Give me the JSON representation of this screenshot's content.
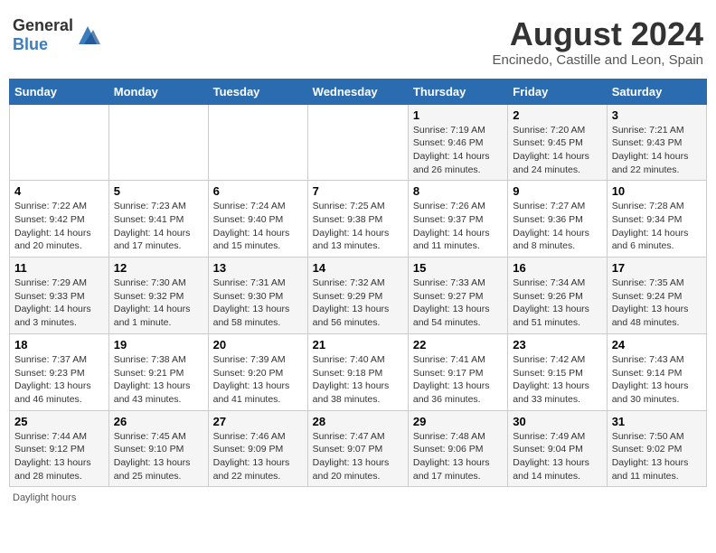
{
  "header": {
    "logo_general": "General",
    "logo_blue": "Blue",
    "month_year": "August 2024",
    "location": "Encinedo, Castille and Leon, Spain"
  },
  "days_of_week": [
    "Sunday",
    "Monday",
    "Tuesday",
    "Wednesday",
    "Thursday",
    "Friday",
    "Saturday"
  ],
  "weeks": [
    [
      {
        "day": "",
        "info": ""
      },
      {
        "day": "",
        "info": ""
      },
      {
        "day": "",
        "info": ""
      },
      {
        "day": "",
        "info": ""
      },
      {
        "day": "1",
        "info": "Sunrise: 7:19 AM\nSunset: 9:46 PM\nDaylight: 14 hours and 26 minutes."
      },
      {
        "day": "2",
        "info": "Sunrise: 7:20 AM\nSunset: 9:45 PM\nDaylight: 14 hours and 24 minutes."
      },
      {
        "day": "3",
        "info": "Sunrise: 7:21 AM\nSunset: 9:43 PM\nDaylight: 14 hours and 22 minutes."
      }
    ],
    [
      {
        "day": "4",
        "info": "Sunrise: 7:22 AM\nSunset: 9:42 PM\nDaylight: 14 hours and 20 minutes."
      },
      {
        "day": "5",
        "info": "Sunrise: 7:23 AM\nSunset: 9:41 PM\nDaylight: 14 hours and 17 minutes."
      },
      {
        "day": "6",
        "info": "Sunrise: 7:24 AM\nSunset: 9:40 PM\nDaylight: 14 hours and 15 minutes."
      },
      {
        "day": "7",
        "info": "Sunrise: 7:25 AM\nSunset: 9:38 PM\nDaylight: 14 hours and 13 minutes."
      },
      {
        "day": "8",
        "info": "Sunrise: 7:26 AM\nSunset: 9:37 PM\nDaylight: 14 hours and 11 minutes."
      },
      {
        "day": "9",
        "info": "Sunrise: 7:27 AM\nSunset: 9:36 PM\nDaylight: 14 hours and 8 minutes."
      },
      {
        "day": "10",
        "info": "Sunrise: 7:28 AM\nSunset: 9:34 PM\nDaylight: 14 hours and 6 minutes."
      }
    ],
    [
      {
        "day": "11",
        "info": "Sunrise: 7:29 AM\nSunset: 9:33 PM\nDaylight: 14 hours and 3 minutes."
      },
      {
        "day": "12",
        "info": "Sunrise: 7:30 AM\nSunset: 9:32 PM\nDaylight: 14 hours and 1 minute."
      },
      {
        "day": "13",
        "info": "Sunrise: 7:31 AM\nSunset: 9:30 PM\nDaylight: 13 hours and 58 minutes."
      },
      {
        "day": "14",
        "info": "Sunrise: 7:32 AM\nSunset: 9:29 PM\nDaylight: 13 hours and 56 minutes."
      },
      {
        "day": "15",
        "info": "Sunrise: 7:33 AM\nSunset: 9:27 PM\nDaylight: 13 hours and 54 minutes."
      },
      {
        "day": "16",
        "info": "Sunrise: 7:34 AM\nSunset: 9:26 PM\nDaylight: 13 hours and 51 minutes."
      },
      {
        "day": "17",
        "info": "Sunrise: 7:35 AM\nSunset: 9:24 PM\nDaylight: 13 hours and 48 minutes."
      }
    ],
    [
      {
        "day": "18",
        "info": "Sunrise: 7:37 AM\nSunset: 9:23 PM\nDaylight: 13 hours and 46 minutes."
      },
      {
        "day": "19",
        "info": "Sunrise: 7:38 AM\nSunset: 9:21 PM\nDaylight: 13 hours and 43 minutes."
      },
      {
        "day": "20",
        "info": "Sunrise: 7:39 AM\nSunset: 9:20 PM\nDaylight: 13 hours and 41 minutes."
      },
      {
        "day": "21",
        "info": "Sunrise: 7:40 AM\nSunset: 9:18 PM\nDaylight: 13 hours and 38 minutes."
      },
      {
        "day": "22",
        "info": "Sunrise: 7:41 AM\nSunset: 9:17 PM\nDaylight: 13 hours and 36 minutes."
      },
      {
        "day": "23",
        "info": "Sunrise: 7:42 AM\nSunset: 9:15 PM\nDaylight: 13 hours and 33 minutes."
      },
      {
        "day": "24",
        "info": "Sunrise: 7:43 AM\nSunset: 9:14 PM\nDaylight: 13 hours and 30 minutes."
      }
    ],
    [
      {
        "day": "25",
        "info": "Sunrise: 7:44 AM\nSunset: 9:12 PM\nDaylight: 13 hours and 28 minutes."
      },
      {
        "day": "26",
        "info": "Sunrise: 7:45 AM\nSunset: 9:10 PM\nDaylight: 13 hours and 25 minutes."
      },
      {
        "day": "27",
        "info": "Sunrise: 7:46 AM\nSunset: 9:09 PM\nDaylight: 13 hours and 22 minutes."
      },
      {
        "day": "28",
        "info": "Sunrise: 7:47 AM\nSunset: 9:07 PM\nDaylight: 13 hours and 20 minutes."
      },
      {
        "day": "29",
        "info": "Sunrise: 7:48 AM\nSunset: 9:06 PM\nDaylight: 13 hours and 17 minutes."
      },
      {
        "day": "30",
        "info": "Sunrise: 7:49 AM\nSunset: 9:04 PM\nDaylight: 13 hours and 14 minutes."
      },
      {
        "day": "31",
        "info": "Sunrise: 7:50 AM\nSunset: 9:02 PM\nDaylight: 13 hours and 11 minutes."
      }
    ]
  ],
  "footer": {
    "daylight_label": "Daylight hours"
  }
}
